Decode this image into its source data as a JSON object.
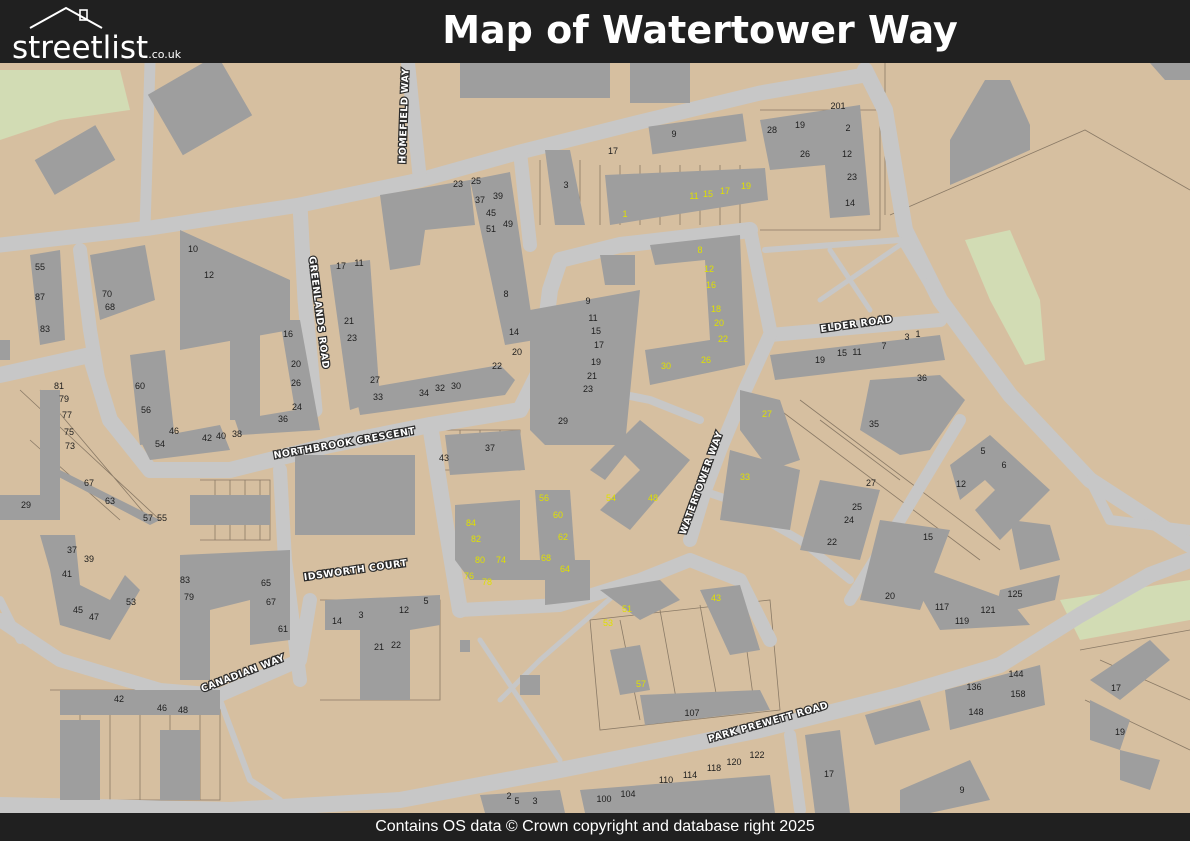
{
  "header": {
    "logo_name": "streetlist",
    "logo_suffix": ".co.uk",
    "title": "Map of Watertower Way"
  },
  "footer": {
    "attribution": "Contains OS data © Crown copyright and database right 2025"
  },
  "colors": {
    "land": "#d6bfa0",
    "road": "#c7c7c7",
    "building": "#9e9e9e",
    "green": "#d2dcb4",
    "bar": "#202020",
    "highlight_number": "#e0e000"
  },
  "streets": {
    "homefield_way": "HOMEFIELD WAY",
    "greenlands_road": "GREENLANDS ROAD",
    "northbrook_crescent": "NORTHBROOK CRESCENT",
    "idsworth_court": "IDSWORTH COURT",
    "canadian_way": "CANADIAN WAY",
    "elder_road": "ELDER ROAD",
    "watertower_way": "WATERTOWER WAY",
    "park_prewett_road": "PARK PREWETT ROAD"
  },
  "house_numbers": [
    "23",
    "25",
    "37",
    "39",
    "45",
    "49",
    "51",
    "8",
    "14",
    "20",
    "22",
    "17",
    "11",
    "21",
    "23",
    "27",
    "33",
    "34",
    "32",
    "30",
    "10",
    "12",
    "16",
    "20",
    "26",
    "24",
    "36",
    "55",
    "87",
    "83",
    "70",
    "68",
    "60",
    "56",
    "46",
    "54",
    "42",
    "40",
    "38",
    "81",
    "79",
    "77",
    "75",
    "73",
    "67",
    "63",
    "57",
    "55",
    "29",
    "43",
    "37",
    "9",
    "11",
    "15",
    "17",
    "19",
    "21",
    "23",
    "29",
    "3",
    "17",
    "9",
    "28",
    "19",
    "2",
    "201",
    "26",
    "12",
    "23",
    "14",
    "37",
    "39",
    "41",
    "45",
    "47",
    "53",
    "83",
    "79",
    "65",
    "67",
    "61",
    "14",
    "3",
    "12",
    "5",
    "21",
    "22",
    "42",
    "46",
    "48",
    "36",
    "35",
    "3",
    "1",
    "7",
    "11",
    "15",
    "19",
    "5",
    "6",
    "12",
    "27",
    "25",
    "24",
    "22",
    "15",
    "20",
    "117",
    "119",
    "121",
    "125",
    "107",
    "17",
    "9",
    "136",
    "144",
    "158",
    "148",
    "17",
    "19",
    "2",
    "5",
    "3",
    "100",
    "104",
    "110",
    "114",
    "118",
    "120",
    "122"
  ],
  "watertower_way_numbers": [
    "1",
    "11",
    "15",
    "17",
    "19",
    "8",
    "12",
    "16",
    "18",
    "20",
    "22",
    "30",
    "26",
    "27",
    "33",
    "56",
    "60",
    "62",
    "84",
    "82",
    "80",
    "74",
    "68",
    "64",
    "76",
    "78",
    "54",
    "48",
    "51",
    "53",
    "43",
    "57"
  ]
}
